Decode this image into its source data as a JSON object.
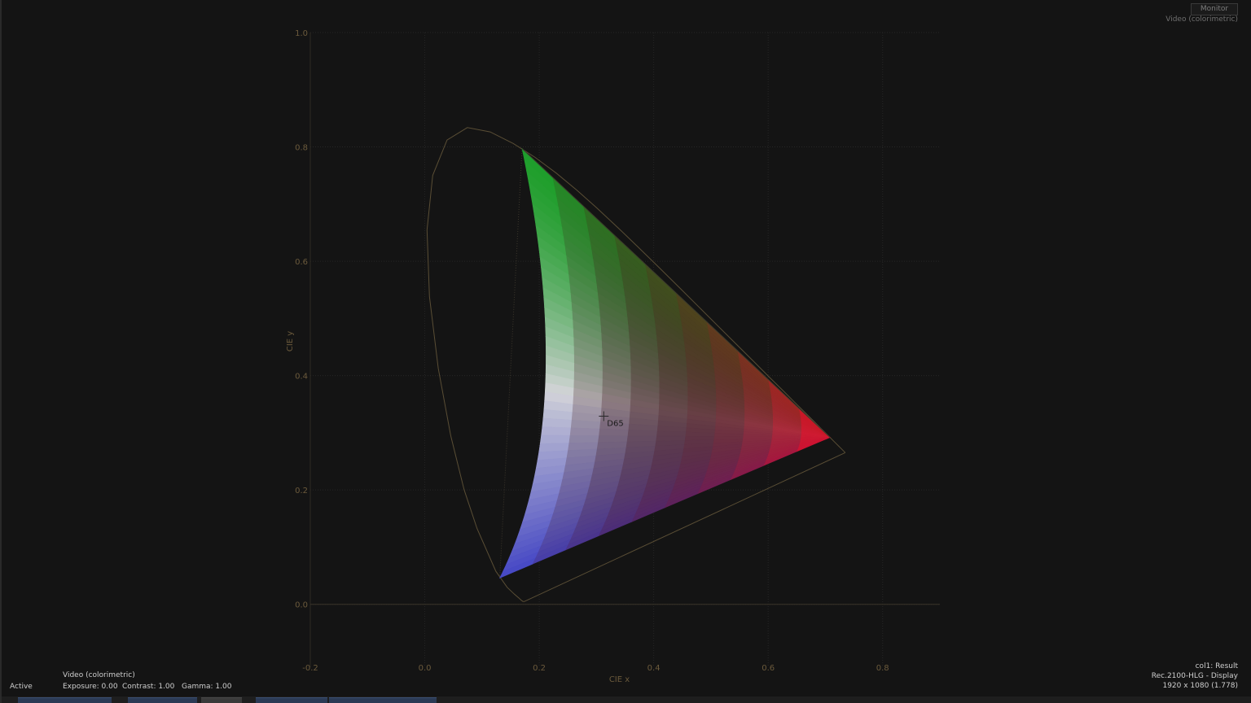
{
  "monitor_button": "Monitor",
  "scope_mode": "Video (colorimetric)",
  "hud": {
    "status": "Active",
    "mode": "Video (colorimetric)",
    "exposure": "Exposure: 0.00",
    "contrast": "Contrast: 1.00",
    "gamma": "Gamma: 1.00",
    "source": "col1: Result",
    "colorspace": "Rec.2100-HLG - Display",
    "resolution": "1920 x 1080 (1.778)"
  },
  "colors": {
    "grid": "#262626",
    "axis": "#6b5a3c",
    "locus": "#5a4e35",
    "red": "#e0102a",
    "green": "#1faa2e",
    "blue": "#3a4fd0",
    "white": "#e8ecf0"
  },
  "chart_data": {
    "type": "scatter",
    "xlabel": "CIE x",
    "ylabel": "CIE y",
    "xlim": [
      -0.2,
      0.9
    ],
    "ylim": [
      -0.11,
      1.0
    ],
    "xticks": [
      -0.2,
      0.0,
      0.2,
      0.4,
      0.6,
      0.8
    ],
    "yticks": [
      0.0,
      0.2,
      0.4,
      0.6,
      0.8,
      1.0
    ],
    "grid": true,
    "spectral_locus": [
      [
        0.1741,
        0.005
      ],
      [
        0.1738,
        0.0049
      ],
      [
        0.1733,
        0.0048
      ],
      [
        0.1726,
        0.0048
      ],
      [
        0.1714,
        0.0051
      ],
      [
        0.1689,
        0.0069
      ],
      [
        0.1644,
        0.0109
      ],
      [
        0.1566,
        0.0177
      ],
      [
        0.144,
        0.0297
      ],
      [
        0.1241,
        0.0578
      ],
      [
        0.0913,
        0.1327
      ],
      [
        0.0687,
        0.2007
      ],
      [
        0.0454,
        0.295
      ],
      [
        0.0235,
        0.4127
      ],
      [
        0.0082,
        0.5384
      ],
      [
        0.0039,
        0.6548
      ],
      [
        0.0139,
        0.7502
      ],
      [
        0.0389,
        0.812
      ],
      [
        0.0743,
        0.8338
      ],
      [
        0.1142,
        0.8262
      ],
      [
        0.1547,
        0.8059
      ],
      [
        0.1929,
        0.7816
      ],
      [
        0.2296,
        0.7543
      ],
      [
        0.2658,
        0.7243
      ],
      [
        0.3016,
        0.6923
      ],
      [
        0.3373,
        0.6589
      ],
      [
        0.3731,
        0.6245
      ],
      [
        0.4087,
        0.5896
      ],
      [
        0.4441,
        0.5547
      ],
      [
        0.4788,
        0.5202
      ],
      [
        0.5125,
        0.4866
      ],
      [
        0.5448,
        0.4544
      ],
      [
        0.5752,
        0.4242
      ],
      [
        0.6029,
        0.3965
      ],
      [
        0.627,
        0.3725
      ],
      [
        0.6482,
        0.3514
      ],
      [
        0.6658,
        0.334
      ],
      [
        0.6801,
        0.3197
      ],
      [
        0.6915,
        0.3083
      ],
      [
        0.7006,
        0.2993
      ],
      [
        0.7079,
        0.292
      ],
      [
        0.714,
        0.2859
      ],
      [
        0.719,
        0.2809
      ],
      [
        0.723,
        0.277
      ],
      [
        0.726,
        0.274
      ],
      [
        0.7347,
        0.2653
      ]
    ],
    "gamut_primaries": {
      "red": [
        0.708,
        0.292
      ],
      "green": [
        0.17,
        0.797
      ],
      "blue": [
        0.131,
        0.046
      ]
    },
    "white_point": {
      "name": "D65",
      "xy": [
        0.3127,
        0.329
      ]
    }
  }
}
